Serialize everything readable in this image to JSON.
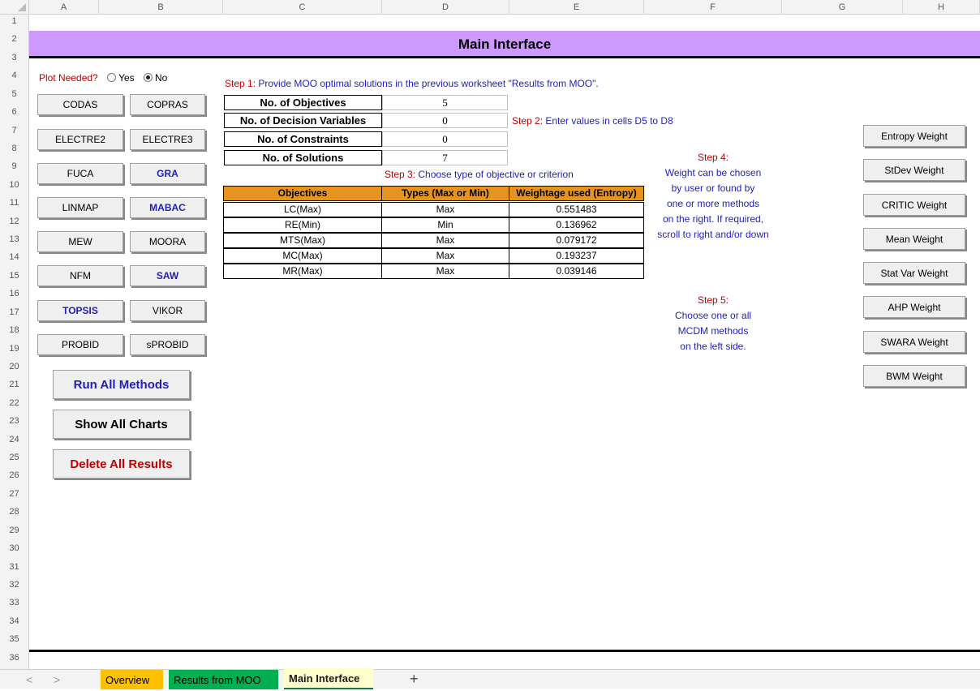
{
  "columns": [
    "A",
    "B",
    "C",
    "D",
    "E",
    "F",
    "G",
    "H"
  ],
  "rows": [
    "1",
    "2",
    "3",
    "4",
    "5",
    "6",
    "7",
    "8",
    "9",
    "10",
    "11",
    "12",
    "13",
    "14",
    "15",
    "16",
    "17",
    "18",
    "19",
    "20",
    "21",
    "22",
    "23",
    "24",
    "25",
    "26",
    "27",
    "28",
    "29",
    "30",
    "31",
    "32",
    "33",
    "34",
    "35",
    "36"
  ],
  "title": "Main Interface",
  "plot": {
    "label": "Plot Needed?",
    "yes": "Yes",
    "no": "No",
    "selected": "No"
  },
  "methods": [
    "CODAS",
    "COPRAS",
    "ELECTRE2",
    "ELECTRE3",
    "FUCA",
    "GRA",
    "LINMAP",
    "MABAC",
    "MEW",
    "MOORA",
    "NFM",
    "SAW",
    "TOPSIS",
    "VIKOR",
    "PROBID",
    "sPROBID"
  ],
  "actions": {
    "run": "Run All Methods",
    "show": "Show All Charts",
    "delete": "Delete All Results"
  },
  "step1": {
    "prefix": "Step 1:",
    "text": " Provide MOO optimal solutions in the previous worksheet \"Results from MOO\"."
  },
  "step2": {
    "prefix": "Step 2:",
    "text": " Enter values in cells D5 to D8"
  },
  "step3": {
    "prefix": "Step 3:",
    "text": " Choose type of objective or criterion"
  },
  "params": [
    {
      "label": "No. of Objectives",
      "value": "5"
    },
    {
      "label": "No. of Decision Variables",
      "value": "0"
    },
    {
      "label": "No. of Constraints",
      "value": "0"
    },
    {
      "label": "No. of Solutions",
      "value": "7"
    }
  ],
  "objectives_table": {
    "headers": [
      "Objectives",
      "Types (Max or Min)",
      "Weightage used (Entropy)"
    ],
    "rows": [
      [
        "LC(Max)",
        "Max",
        "0.551483"
      ],
      [
        "RE(Min)",
        "Min",
        "0.136962"
      ],
      [
        "MTS(Max)",
        "Max",
        "0.079172"
      ],
      [
        "MC(Max)",
        "Max",
        "0.193237"
      ],
      [
        "MR(Max)",
        "Max",
        "0.039146"
      ]
    ]
  },
  "step4": {
    "title": "Step 4:",
    "lines": [
      "Weight can be chosen",
      "by user or found by",
      "one or more methods",
      "on the right. If required,",
      "scroll to right and/or down"
    ]
  },
  "step5": {
    "title": "Step 5:",
    "lines": [
      "Choose one or all",
      "MCDM methods",
      "on the left side."
    ]
  },
  "weights": [
    "Entropy Weight",
    "StDev Weight",
    "CRITIC Weight",
    "Mean Weight",
    "Stat Var Weight",
    "AHP Weight",
    "SWARA Weight",
    "BWM Weight"
  ],
  "tabs": [
    {
      "label": "Overview",
      "color": "#ffc000"
    },
    {
      "label": "Results from MOO",
      "color": "#00b050"
    },
    {
      "label": "Main Interface",
      "color": "#ffffcc"
    }
  ],
  "add_tab": "+",
  "nav": {
    "prev": "<",
    "next": ">"
  }
}
